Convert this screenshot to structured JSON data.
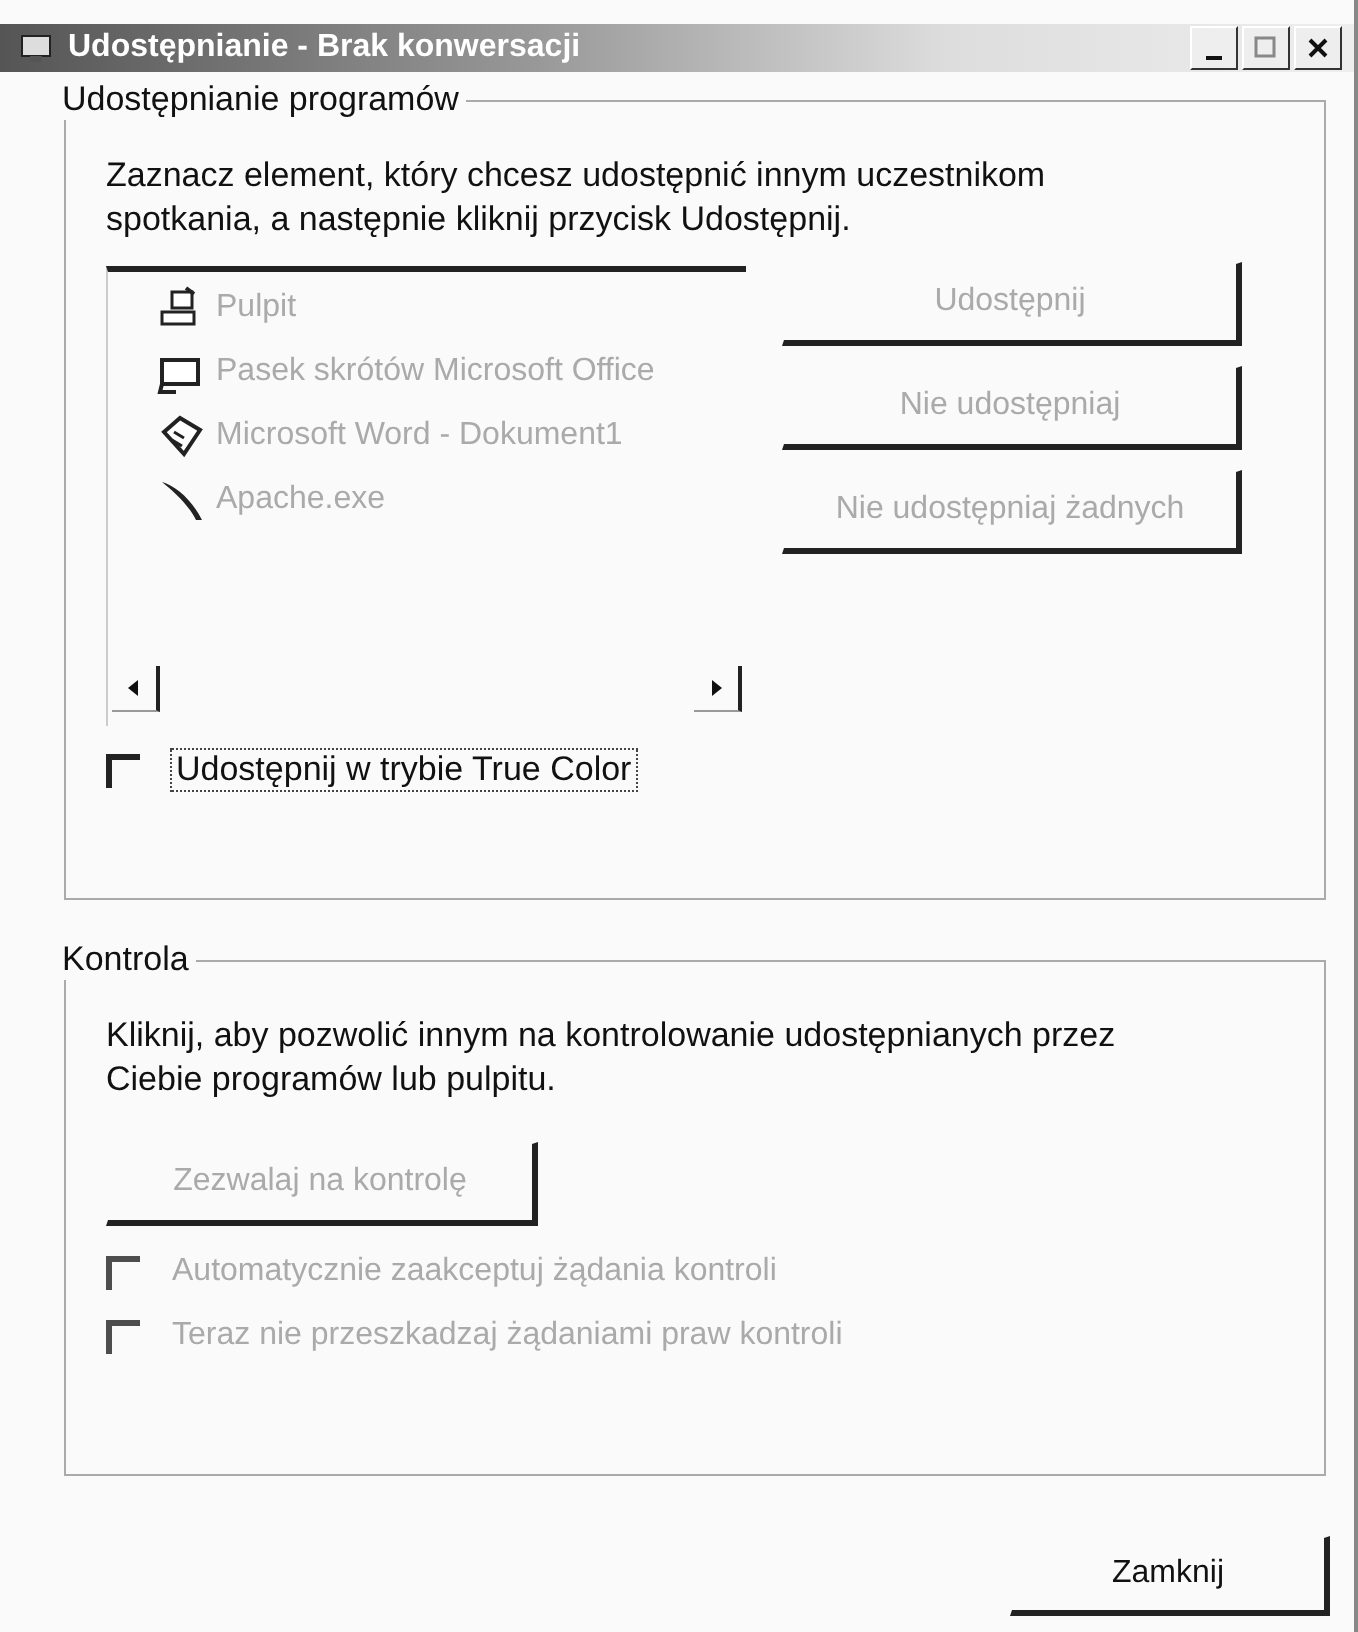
{
  "window": {
    "title": "Udostępnianie - Brak konwersacji"
  },
  "sharing": {
    "title": "Udostępnianie programów",
    "description": "Zaznacz element, który chcesz udostępnić innym uczestnikom spotkania, a następnie kliknij przycisk Udostępnij.",
    "programs": [
      {
        "label": "Pulpit",
        "kind": "desktop",
        "disabled": true
      },
      {
        "label": "Pasek skrótów Microsoft Office",
        "kind": "toolbar",
        "disabled": true
      },
      {
        "label": "Microsoft Word - Dokument1",
        "kind": "document",
        "disabled": true
      },
      {
        "label": "Apache.exe",
        "kind": "feather",
        "disabled": true
      }
    ],
    "buttons": [
      {
        "label": "Udostępnij",
        "disabled": true
      },
      {
        "label": "Nie udostępniaj",
        "disabled": true
      },
      {
        "label": "Nie udostępniaj żadnych",
        "disabled": true
      }
    ],
    "true_color": {
      "label": "Udostępnij w trybie True Color",
      "checked": false,
      "disabled": false,
      "focused": true
    }
  },
  "control": {
    "title": "Kontrola",
    "description": "Kliknij, aby pozwolić innym na kontrolowanie udostępnianych przez Ciebie programów lub pulpitu.",
    "button": {
      "label": "Zezwalaj na kontrolę",
      "disabled": true
    },
    "options": [
      {
        "label": "Automatycznie zaakceptuj żądania kontroli",
        "checked": false,
        "disabled": true
      },
      {
        "label": "Teraz nie przeszkadzaj żądaniami praw kontroli",
        "checked": false,
        "disabled": true
      }
    ]
  },
  "close_button": {
    "label": "Zamknij",
    "disabled": false
  }
}
